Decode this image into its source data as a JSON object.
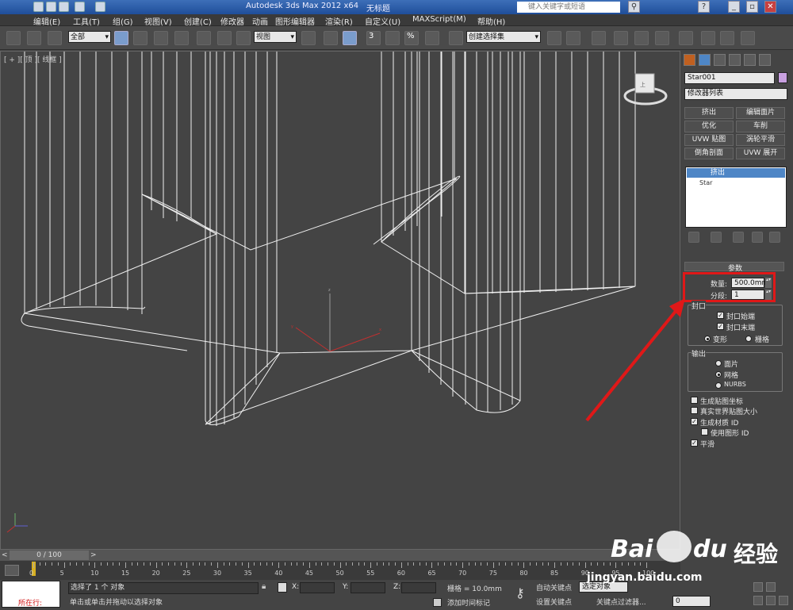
{
  "title_bar": {
    "app_title": "Autodesk 3ds Max  2012 x64",
    "doc_title": "无标题",
    "search_placeholder": "键入关键字或短语"
  },
  "menu": [
    "编辑(E)",
    "工具(T)",
    "组(G)",
    "视图(V)",
    "创建(C)",
    "修改器",
    "动画",
    "图形编辑器",
    "渲染(R)",
    "自定义(U)",
    "MAXScript(M)",
    "帮助(H)"
  ],
  "toolbar": {
    "filter_combo": "全部",
    "view_combo": "视图",
    "selection_set_combo": "创建选择集",
    "snap_label": "3",
    "percent_label": "%"
  },
  "viewport": {
    "label": "[ + ][ 顶 ][ 线框 ]",
    "gizmo_label": "上"
  },
  "command_panel": {
    "object_name": "Star001",
    "object_color": "#c8a0e0",
    "modifier_list": "修改器列表",
    "modifier_buttons": [
      "挤出",
      "编辑面片",
      "优化",
      "车削",
      "UVW 贴图",
      "涡轮平滑",
      "倒角剖面",
      "UVW 展开"
    ],
    "stack": [
      "挤出",
      "Star"
    ],
    "rollout_title": "参数",
    "amount_label": "数量:",
    "amount_value": "500.0mm",
    "segments_label": "分段:",
    "segments_value": "1",
    "cap_group": "封口",
    "cap_start": "封口始端",
    "cap_end": "封口末端",
    "morph": "变形",
    "grid": "栅格",
    "output_group": "输出",
    "out_patch": "面片",
    "out_mesh": "网格",
    "out_nurbs": "NURBS",
    "gen_mapping": "生成贴图坐标",
    "real_world": "真实世界贴图大小",
    "gen_matid": "生成材质 ID",
    "use_shape_id": "使用图形 ID",
    "smooth": "平滑"
  },
  "timeline": {
    "frame_range": "0 / 100",
    "ticks": [
      "0",
      "5",
      "10",
      "15",
      "20",
      "25",
      "30",
      "35",
      "40",
      "45",
      "50",
      "55",
      "60",
      "65",
      "70",
      "75",
      "80",
      "85",
      "90",
      "95",
      "100"
    ]
  },
  "status": {
    "maxscript_text": "所在行:",
    "selected_text": "选择了 1 个 对象",
    "prompt_text": "单击或单击并拖动以选择对象",
    "x_label": "X:",
    "y_label": "Y:",
    "z_label": "Z:",
    "grid_text": "栅格 = 10.0mm",
    "add_time_tag": "添加时间标记",
    "auto_key": "自动关键点",
    "set_key": "设置关键点",
    "selected_combo": "选定对象",
    "key_filters": "关键点过滤器...",
    "frame_field": "0"
  },
  "watermark": {
    "brand": "Bai",
    "brand2": "du",
    "cn": "经验",
    "url": "jingyan.baidu.com"
  }
}
